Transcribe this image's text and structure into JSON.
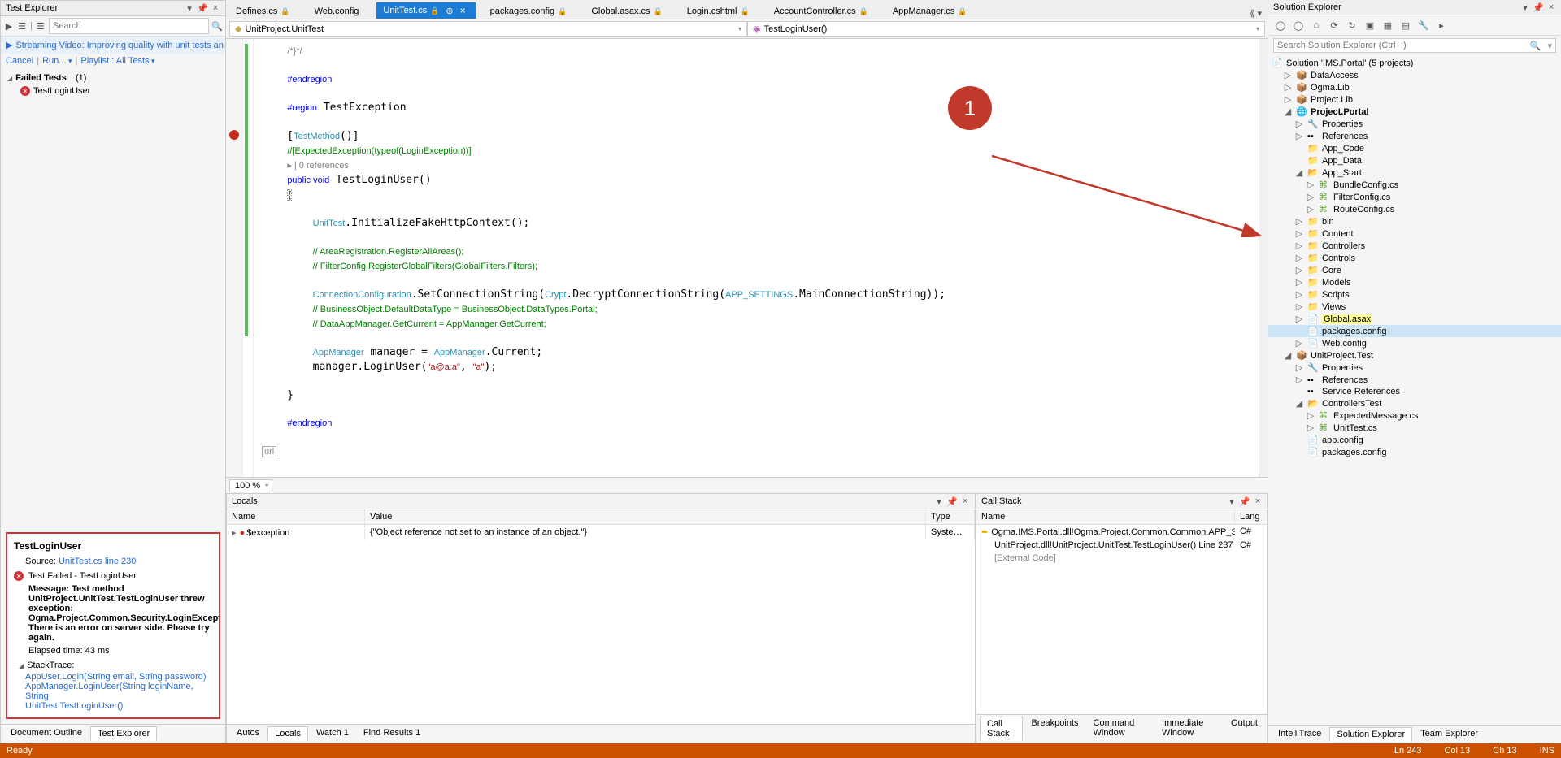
{
  "testExplorer": {
    "title": "Test Explorer",
    "searchPlaceholder": "Search",
    "banner": "Streaming Video: Improving quality with unit tests an",
    "links": {
      "cancel": "Cancel",
      "run": "Run...",
      "playlist": "Playlist : All Tests"
    },
    "group": "Failed Tests",
    "groupCount": "(1)",
    "item": "TestLoginUser",
    "details": {
      "name": "TestLoginUser",
      "sourceLabel": "Source:",
      "source": "UnitTest.cs line 230",
      "failLabel": "Test Failed - TestLoginUser",
      "msgHead": "Message:",
      "msg1": "Test method UnitProject.UnitTest.TestLoginUser threw exception:",
      "msg2": "Ogma.Project.Common.Security.LoginException: There is an error on server side. Please try again.",
      "elapsed": "Elapsed time: 43 ms",
      "stackHead": "StackTrace:",
      "stack1": "AppUser.Login(String email, String password)",
      "stack2": "AppManager.LoginUser(String loginName, String",
      "stack3": "UnitTest.TestLoginUser()"
    }
  },
  "leftTabs": {
    "docOutline": "Document Outline",
    "testExplorer": "Test Explorer"
  },
  "docTabs": {
    "t1": "Defines.cs",
    "t2": "Web.config",
    "t3": "UnitTest.cs",
    "t4": "packages.config",
    "t5": "Global.asax.cs",
    "t6": "Login.cshtml",
    "t7": "AccountController.cs",
    "t8": "AppManager.cs"
  },
  "nav": {
    "class": "UnitProject.UnitTest",
    "method": "TestLoginUser()"
  },
  "zoom": "100 %",
  "urlBits": "url",
  "locals": {
    "title": "Locals",
    "hName": "Name",
    "hValue": "Value",
    "hType": "Type",
    "rName": "$exception",
    "rValue": "{\"Object reference not set to an instance of an object.\"}",
    "rType": "System.N"
  },
  "callStack": {
    "title": "Call Stack",
    "hName": "Name",
    "hLang": "Lang",
    "r1": "Ogma.IMS.Portal.dll!Ogma.Project.Common.Common.APP_SETTIN",
    "l1": "C#",
    "r2": "UnitProject.dll!UnitProject.UnitTest.TestLoginUser() Line 237",
    "l2": "C#",
    "r3": "[External Code]"
  },
  "centerTabs": {
    "autos": "Autos",
    "locals": "Locals",
    "watch": "Watch 1",
    "find": "Find Results 1",
    "callStack": "Call Stack",
    "bp": "Breakpoints",
    "cmd": "Command Window",
    "imm": "Immediate Window",
    "out": "Output"
  },
  "explorer": {
    "title": "Solution Explorer",
    "searchPlaceholder": "Search Solution Explorer (Ctrl+;)",
    "sln": "Solution 'IMS.Portal' (5 projects)",
    "p1": "DataAccess",
    "p2": "Ogma.Lib",
    "p3": "Project.Lib",
    "p4": "Project.Portal",
    "prop": "Properties",
    "ref": "References",
    "ac": "App_Code",
    "ad": "App_Data",
    "as": "App_Start",
    "bc": "BundleConfig.cs",
    "fc": "FilterConfig.cs",
    "rc": "RouteConfig.cs",
    "bin": "bin",
    "content": "Content",
    "ctrls": "Controllers",
    "cntrl": "Controls",
    "core": "Core",
    "models": "Models",
    "scripts": "Scripts",
    "views": "Views",
    "ga": "Global.asax",
    "pk": "packages.config",
    "wc": "Web.config",
    "p5": "UnitProject.Test",
    "svcRef": "Service References",
    "ctest": "ControllersTest",
    "em": "ExpectedMessage.cs",
    "ut": "UnitTest.cs",
    "appc": "app.config",
    "pkg2": "packages.config"
  },
  "rightTabs": {
    "it": "IntelliTrace",
    "se": "Solution Explorer",
    "te": "Team Explorer"
  },
  "status": {
    "ready": "Ready",
    "ln": "Ln 243",
    "col": "Col 13",
    "ch": "Ch 13",
    "ins": "INS"
  }
}
